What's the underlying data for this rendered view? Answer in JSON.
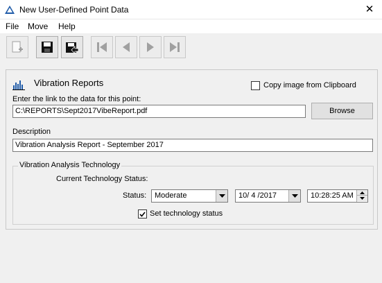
{
  "window": {
    "title": "New User-Defined Point Data",
    "close_glyph": "✕"
  },
  "menu": [
    "File",
    "Move",
    "Help"
  ],
  "toolbar": {
    "icons": [
      "add-point-icon",
      "save-icon",
      "save-and-exit-icon",
      "first-record-icon",
      "previous-record-icon",
      "next-record-icon",
      "last-record-icon"
    ]
  },
  "report": {
    "title": "Vibration Reports",
    "copy_clipboard_label": "Copy image from Clipboard",
    "copy_clipboard_checked": false,
    "link_label": "Enter the link to the data for this point:",
    "link_value": "C:\\REPORTS\\Sept2017VibeReport.pdf",
    "browse_label": "Browse",
    "description_label": "Description",
    "description_value": "Vibration Analysis Report - September 2017"
  },
  "technology": {
    "group_title": "Vibration Analysis Technology",
    "current_status_label": "Current Technology Status:",
    "status_label": "Status:",
    "status_value": "Moderate",
    "date_value": "10/ 4 /2017",
    "time_value": "10:28:25 AM",
    "set_status_label": "Set technology status",
    "set_status_checked": true
  },
  "colors": {
    "window_bg": "#f0f0f0",
    "accent": "#1e5aa8",
    "disabled_icon": "#a0a0a0"
  }
}
